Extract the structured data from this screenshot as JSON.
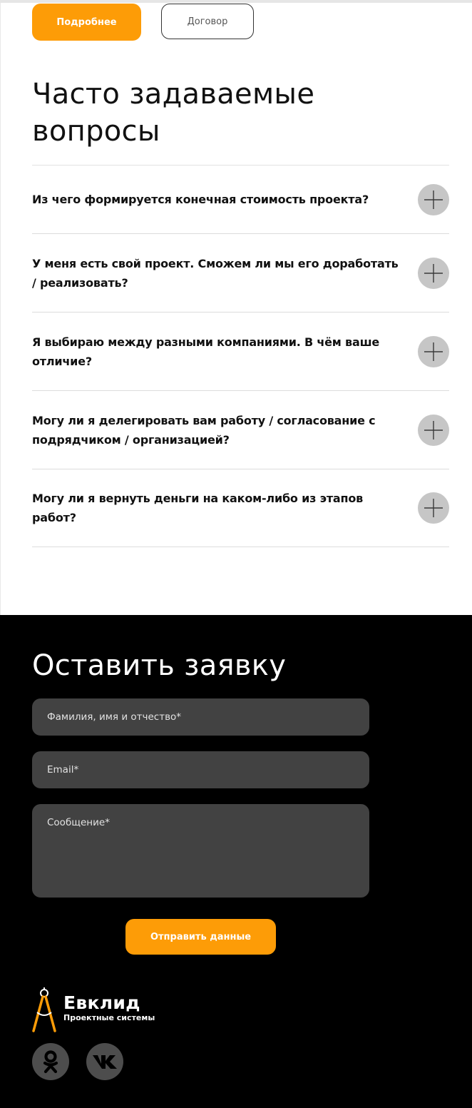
{
  "top_buttons": {
    "more_label": "Подробнее",
    "contract_label": "Договор"
  },
  "faq": {
    "title": "Часто задаваемые вопросы",
    "items": [
      {
        "question": "Из чего формируется конечная стоимость проекта?"
      },
      {
        "question": "У меня есть свой проект. Сможем ли мы его доработать / реализовать?"
      },
      {
        "question": "Я выбираю между разными компаниями. В чём ваше отличие?"
      },
      {
        "question": "Могу ли я делегировать вам работу / согласование с подрядчиком / организацией?"
      },
      {
        "question": "Могу ли я вернуть деньги на каком-либо из этапов работ?"
      }
    ],
    "toggle_icon": "plus-icon"
  },
  "request_form": {
    "title": "Оставить заявку",
    "fio_placeholder": "Фамилия, имя и отчество*",
    "email_placeholder": "Email*",
    "message_placeholder": "Сообщение*",
    "submit_label": "Отправить данные"
  },
  "footer": {
    "logo_name": "Евклид",
    "logo_tagline": "Проектные системы",
    "logo_icon": "compass-icon",
    "social": [
      {
        "name": "odnoklassniki-icon"
      },
      {
        "name": "vk-icon"
      }
    ]
  },
  "colors": {
    "accent": "#fd9c07",
    "dark_bg": "#000000",
    "field_bg": "#424242",
    "toggle_bg": "#c6c6c6",
    "social_bg": "#4d4d4d"
  }
}
